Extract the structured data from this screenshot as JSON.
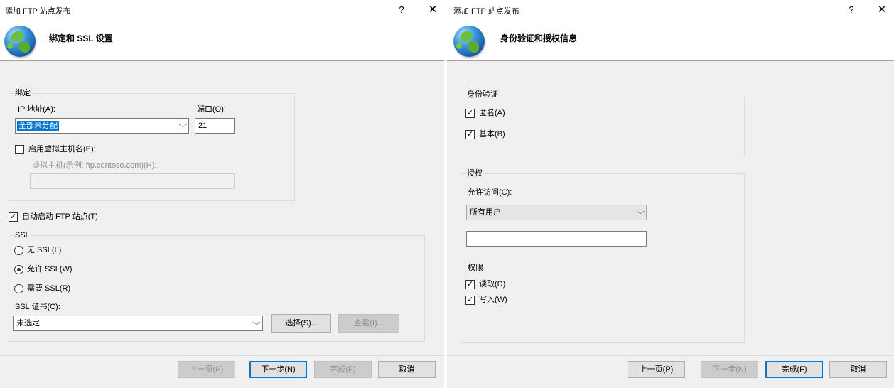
{
  "dialog1": {
    "title": "添加 FTP 站点发布",
    "help": "?",
    "close": "✕",
    "header_title": "绑定和 SSL 设置",
    "binding": {
      "legend": "绑定",
      "ip_label": "IP 地址(A):",
      "ip_value": "全部未分配",
      "port_label": "端口(O):",
      "port_value": "21",
      "virtual_host_checkbox": "启用虚拟主机名(E):",
      "virtual_host_label": "虚拟主机(示例: ftp.contoso.com)(H):",
      "virtual_host_value": ""
    },
    "auto_start": "自动启动 FTP 站点(T)",
    "ssl": {
      "legend": "SSL",
      "options": [
        "无 SSL(L)",
        "允许 SSL(W)",
        "需要 SSL(R)"
      ],
      "selected": 1,
      "cert_label": "SSL 证书(C):",
      "cert_value": "未选定",
      "select_button": "选择(S)...",
      "view_button": "查看(I)..."
    },
    "buttons": {
      "prev": "上一页(P)",
      "next": "下一步(N)",
      "finish": "完成(F)",
      "cancel": "取消"
    }
  },
  "dialog2": {
    "title": "添加 FTP 站点发布",
    "help": "?",
    "close": "✕",
    "header_title": "身份验证和授权信息",
    "authentication": {
      "legend": "身份验证",
      "anonymous": "匿名(A)",
      "basic": "基本(B)"
    },
    "authorization": {
      "legend": "授权",
      "allow_label": "允许访问(C):",
      "allow_value": "所有用户",
      "user_value": "",
      "permissions_label": "权限",
      "read": "读取(D)",
      "write": "写入(W)"
    },
    "buttons": {
      "prev": "上一页(P)",
      "next": "下一步(N)",
      "finish": "完成(F)",
      "cancel": "取消"
    }
  },
  "icons": {
    "check": "✓",
    "dropdown": "⌵",
    "globe": "globe-icon"
  }
}
